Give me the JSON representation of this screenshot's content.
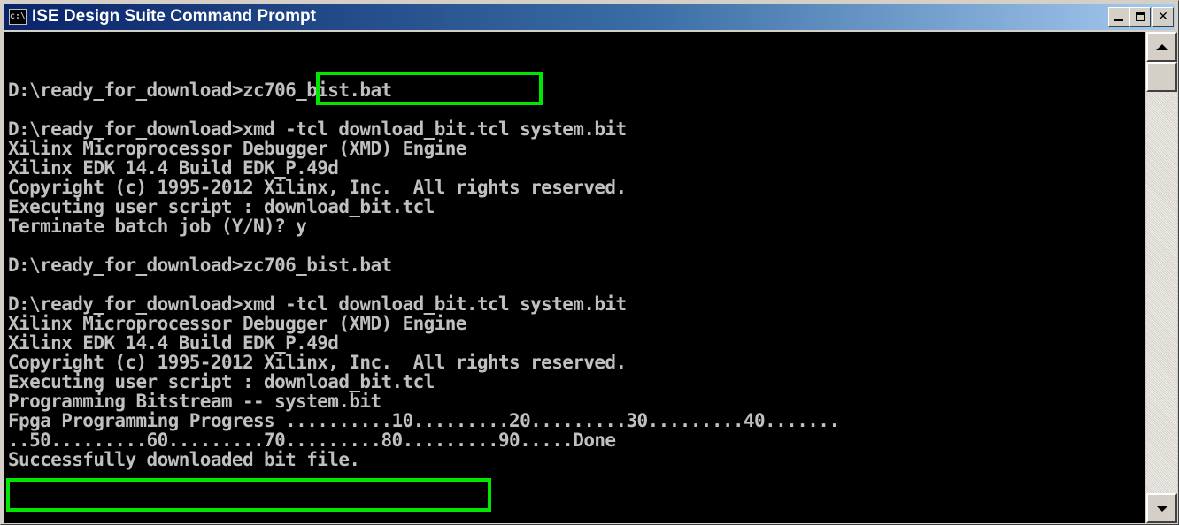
{
  "window": {
    "title": "ISE Design Suite Command Prompt",
    "app_icon_text": "c:\\"
  },
  "console": {
    "lines": [
      "D:\\ready_for_download>zc706_bist.bat",
      "",
      "D:\\ready_for_download>xmd -tcl download_bit.tcl system.bit",
      "Xilinx Microprocessor Debugger (XMD) Engine",
      "Xilinx EDK 14.4 Build EDK_P.49d",
      "Copyright (c) 1995-2012 Xilinx, Inc.  All rights reserved.",
      "Executing user script : download_bit.tcl",
      "Terminate batch job (Y/N)? y",
      "",
      "D:\\ready_for_download>zc706_bist.bat",
      "",
      "D:\\ready_for_download>xmd -tcl download_bit.tcl system.bit",
      "Xilinx Microprocessor Debugger (XMD) Engine",
      "Xilinx EDK 14.4 Build EDK_P.49d",
      "Copyright (c) 1995-2012 Xilinx, Inc.  All rights reserved.",
      "Executing user script : download_bit.tcl",
      "Programming Bitstream -- system.bit",
      "Fpga Programming Progress ..........10.........20.........30.........40.......",
      "..50.........60.........70.........80.........90.....Done",
      "Successfully downloaded bit file."
    ]
  },
  "colors": {
    "console_bg": "#000000",
    "console_text": "#c0c0c0",
    "highlight": "#00e600",
    "title_gradient_start": "#0a246a",
    "title_gradient_end": "#a6caf0"
  },
  "icons": {
    "minimize": "minimize-icon",
    "maximize": "maximize-icon",
    "close": "close-icon",
    "scroll_up": "scroll-up-arrow-icon",
    "scroll_down": "scroll-down-arrow-icon"
  }
}
